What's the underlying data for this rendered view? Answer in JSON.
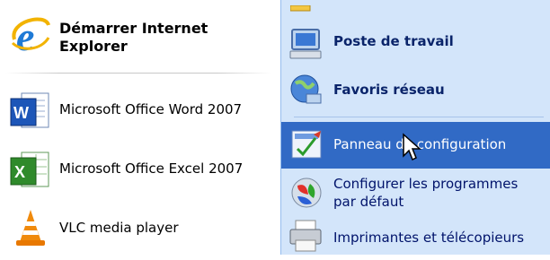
{
  "left_pane": {
    "pinned": {
      "label": "Démarrer Internet\nExplorer",
      "label_line1": "Démarrer Internet",
      "label_line2": "Explorer",
      "icon": "internet-explorer-icon"
    },
    "recent": [
      {
        "label": "Microsoft Office Word 2007",
        "icon": "word-icon"
      },
      {
        "label": "Microsoft Office Excel 2007",
        "icon": "excel-icon"
      },
      {
        "label": "VLC media player",
        "icon": "vlc-icon"
      }
    ]
  },
  "right_pane": {
    "items": [
      {
        "label": "Poste de travail",
        "icon": "my-computer-icon",
        "bold": true
      },
      {
        "label": "Favoris réseau",
        "icon": "network-places-icon",
        "bold": true
      },
      {
        "label": "Panneau de configuration",
        "icon": "control-panel-icon",
        "selected": true
      },
      {
        "label_line1": "Configurer les programmes",
        "label_line2": "par défaut",
        "icon": "default-programs-icon"
      },
      {
        "label": "Imprimantes et télécopieurs",
        "icon": "printers-icon"
      }
    ]
  },
  "colors": {
    "right_bg": "#d3e5fa",
    "selection": "#316ac5",
    "link_text": "#00136b"
  }
}
